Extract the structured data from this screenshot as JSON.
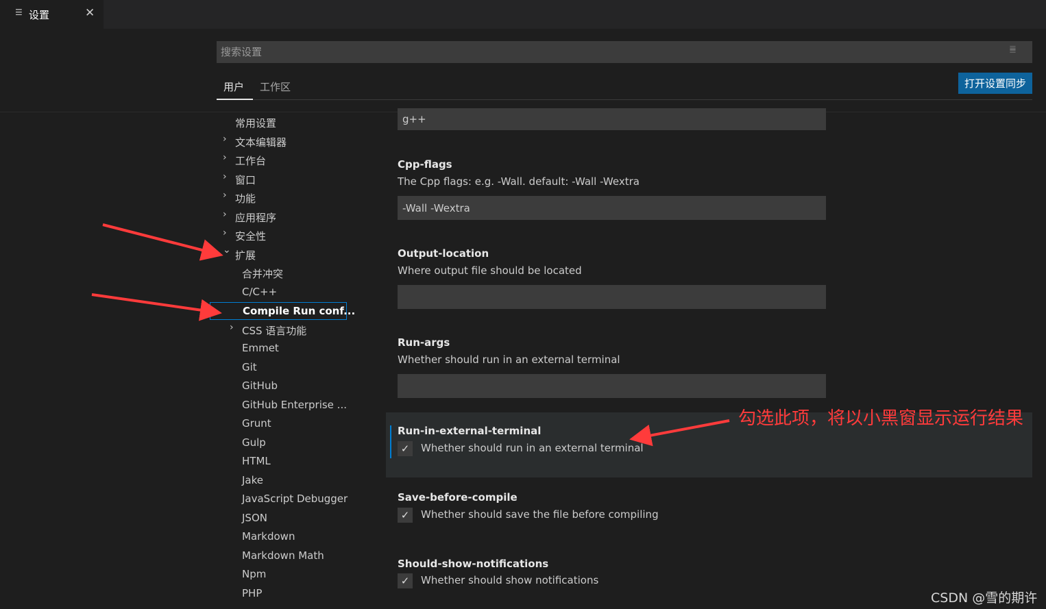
{
  "tab": {
    "title": "设置",
    "icon": "list-icon"
  },
  "search": {
    "placeholder": "搜索设置"
  },
  "scopes": {
    "user": "用户",
    "workspace": "工作区"
  },
  "sync_button": "打开设置同步",
  "toc": [
    {
      "label": "常用设置",
      "chevron": "",
      "level": 0
    },
    {
      "label": "文本编辑器",
      "chevron": "›",
      "level": 0
    },
    {
      "label": "工作台",
      "chevron": "›",
      "level": 0
    },
    {
      "label": "窗口",
      "chevron": "›",
      "level": 0
    },
    {
      "label": "功能",
      "chevron": "›",
      "level": 0
    },
    {
      "label": "应用程序",
      "chevron": "›",
      "level": 0
    },
    {
      "label": "安全性",
      "chevron": "›",
      "level": 0
    },
    {
      "label": "扩展",
      "chevron": "⌄",
      "level": 0
    },
    {
      "label": "合并冲突",
      "chevron": "",
      "level": 1
    },
    {
      "label": "C/C++",
      "chevron": "",
      "level": 1
    },
    {
      "label": "Compile Run conf...",
      "chevron": "",
      "level": 1,
      "active": true
    },
    {
      "label": "CSS 语言功能",
      "chevron": "›",
      "level": 1
    },
    {
      "label": "Emmet",
      "chevron": "",
      "level": 1
    },
    {
      "label": "Git",
      "chevron": "",
      "level": 1
    },
    {
      "label": "GitHub",
      "chevron": "",
      "level": 1
    },
    {
      "label": "GitHub Enterprise ...",
      "chevron": "",
      "level": 1
    },
    {
      "label": "Grunt",
      "chevron": "",
      "level": 1
    },
    {
      "label": "Gulp",
      "chevron": "",
      "level": 1
    },
    {
      "label": "HTML",
      "chevron": "",
      "level": 1
    },
    {
      "label": "Jake",
      "chevron": "",
      "level": 1
    },
    {
      "label": "JavaScript Debugger",
      "chevron": "",
      "level": 1
    },
    {
      "label": "JSON",
      "chevron": "",
      "level": 1
    },
    {
      "label": "Markdown",
      "chevron": "",
      "level": 1
    },
    {
      "label": "Markdown Math",
      "chevron": "",
      "level": 1
    },
    {
      "label": "Npm",
      "chevron": "",
      "level": 1
    },
    {
      "label": "PHP",
      "chevron": "",
      "level": 1
    }
  ],
  "settings": {
    "compiler_value": "g++",
    "cpp_flags": {
      "title": "Cpp-flags",
      "desc": "The Cpp flags: e.g. -Wall. default: -Wall -Wextra",
      "value": "-Wall -Wextra"
    },
    "output_location": {
      "title": "Output-location",
      "desc": "Where output file should be located",
      "value": ""
    },
    "run_args": {
      "title": "Run-args",
      "desc": "Whether should run in an external terminal",
      "value": ""
    },
    "run_in_external_terminal": {
      "title": "Run-in-external-terminal",
      "desc": "Whether should run in an external terminal",
      "checked": true
    },
    "save_before_compile": {
      "title": "Save-before-compile",
      "desc": "Whether should save the file before compiling",
      "checked": true
    },
    "should_show_notifications": {
      "title": "Should-show-notifications",
      "desc": "Whether should show notifications",
      "checked": true
    }
  },
  "annotation_text": "勾选此项，将以小黑窗显示运行结果",
  "watermark": "CSDN @雪的期许",
  "colors": {
    "accent": "#007fd4",
    "button": "#0e639c",
    "annotation": "#ff3b3b"
  }
}
